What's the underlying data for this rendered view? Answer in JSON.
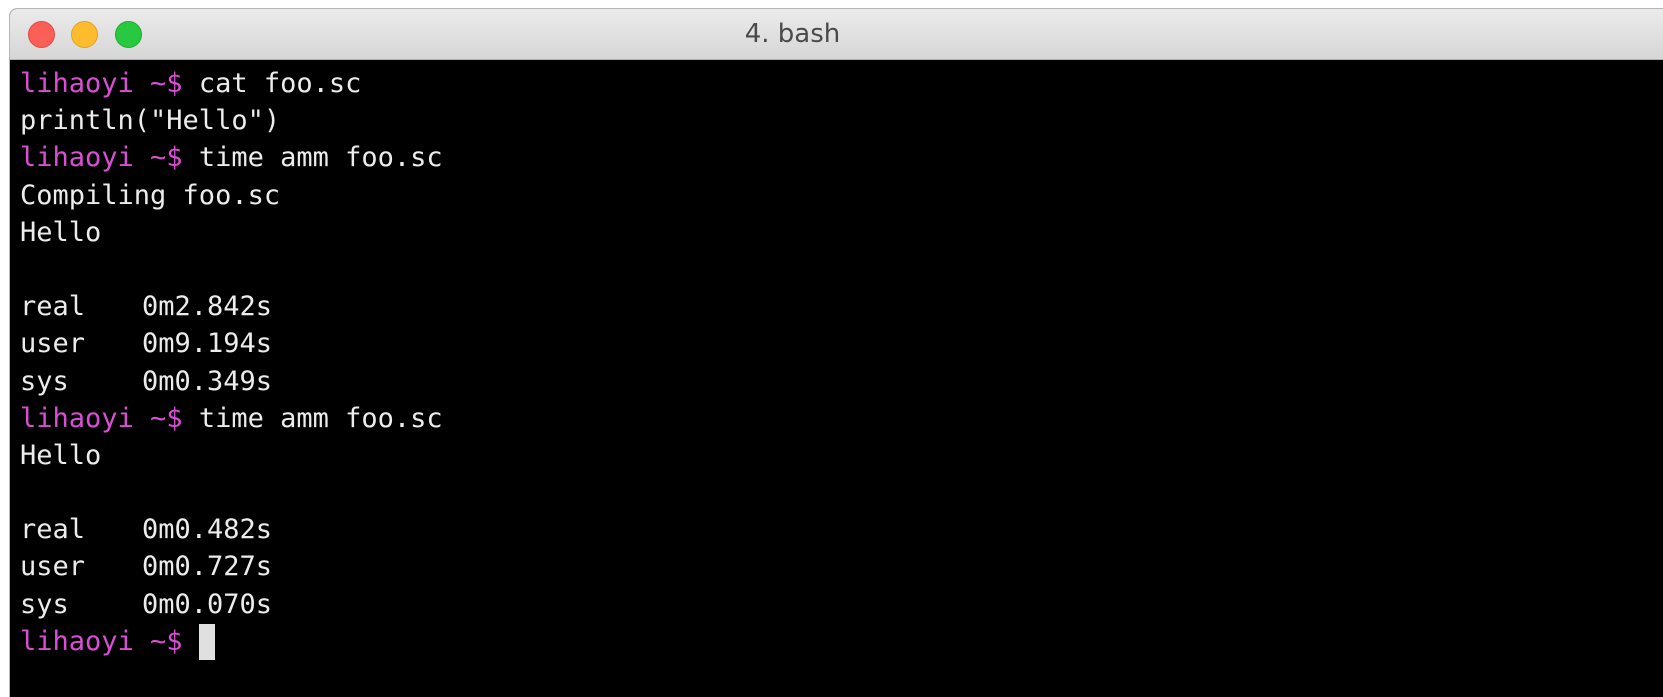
{
  "window": {
    "title": "4. bash"
  },
  "terminal": {
    "prompt": "lihaoyi ~$",
    "lines": [
      {
        "kind": "cmd",
        "text": "cat foo.sc"
      },
      {
        "kind": "out",
        "text": "println(\"Hello\")"
      },
      {
        "kind": "cmd",
        "text": "time amm foo.sc"
      },
      {
        "kind": "out",
        "text": "Compiling foo.sc"
      },
      {
        "kind": "out",
        "text": "Hello"
      },
      {
        "kind": "blank"
      },
      {
        "kind": "timing",
        "label": "real",
        "value": "0m2.842s"
      },
      {
        "kind": "timing",
        "label": "user",
        "value": "0m9.194s"
      },
      {
        "kind": "timing",
        "label": "sys",
        "value": "0m0.349s"
      },
      {
        "kind": "cmd",
        "text": "time amm foo.sc"
      },
      {
        "kind": "out",
        "text": "Hello"
      },
      {
        "kind": "blank"
      },
      {
        "kind": "timing",
        "label": "real",
        "value": "0m0.482s"
      },
      {
        "kind": "timing",
        "label": "user",
        "value": "0m0.727s"
      },
      {
        "kind": "timing",
        "label": "sys",
        "value": "0m0.070s"
      },
      {
        "kind": "input",
        "text": ""
      }
    ]
  },
  "colors": {
    "prompt": "#d94fd3",
    "text": "#ececec",
    "background": "#000000"
  }
}
